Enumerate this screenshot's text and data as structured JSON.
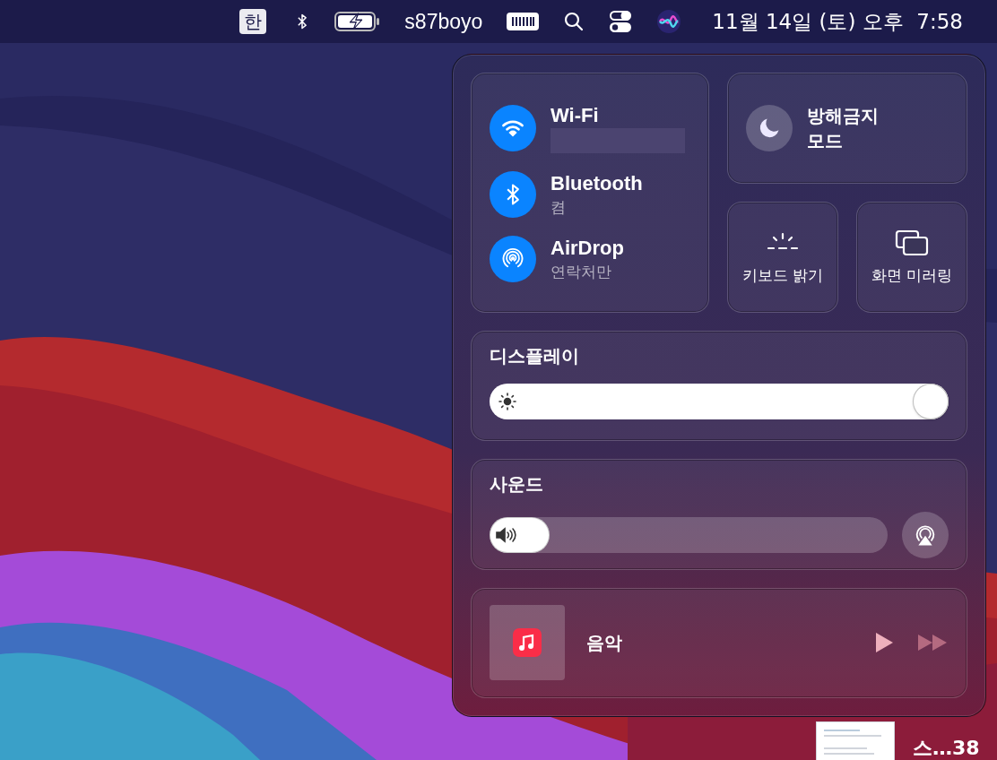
{
  "menu_bar": {
    "input_source": "한",
    "user": "s87boyo",
    "clock": "11월 14일 (토) 오후  7:58"
  },
  "network": [
    {
      "kind": "wifi",
      "title": "Wi-Fi",
      "on": true,
      "subtitle_redacted": true
    },
    {
      "kind": "bluetooth",
      "title": "Bluetooth",
      "subtitle": "켬",
      "on": true
    },
    {
      "kind": "airdrop",
      "title": "AirDrop",
      "subtitle": "연락처만",
      "on": true
    }
  ],
  "do_not_disturb": {
    "title": "방해금지 모드",
    "on": false
  },
  "tiles": [
    {
      "kind": "keyboard",
      "label": "키보드 밝기"
    },
    {
      "kind": "mirroring",
      "label": "화면 미러링"
    }
  ],
  "display": {
    "title": "디스플레이",
    "level": 1.0
  },
  "sound": {
    "title": "사운드",
    "level": 0.15
  },
  "now_playing": {
    "title": "음악"
  },
  "desktop_file": {
    "label": "스…38"
  }
}
